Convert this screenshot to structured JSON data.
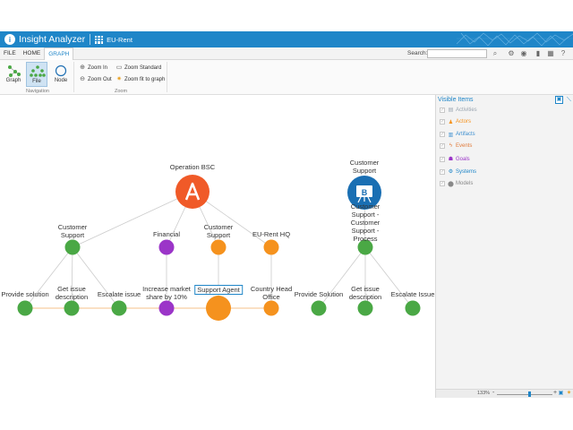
{
  "app": {
    "title": "Insight Analyzer",
    "document": "EU-Rent"
  },
  "menu": {
    "tabs": [
      "FILE",
      "HOME",
      "GRAPH"
    ],
    "active_tab": "GRAPH",
    "search_label": "Search:",
    "search_value": ""
  },
  "ribbon": {
    "buttons": {
      "graph": "Graph",
      "file": "File",
      "node": "Node"
    },
    "navigation_label": "Navigation",
    "zoom": {
      "zoom_in": "Zoom In",
      "zoom_out": "Zoom Out",
      "zoom_standard": "Zoom Standard",
      "zoom_fit": "Zoom fit to graph",
      "group_label": "Zoom"
    }
  },
  "graph": {
    "colors": {
      "actor": "#f5921e",
      "goal": "#9b35c8",
      "process": "#4aa845",
      "model_a": "#f05a28",
      "model_b": "#1a6fb3",
      "edge": "#cccccc",
      "edge_highlight": "#f5c089"
    },
    "labels": {
      "operation_bsc": "Operation BSC",
      "badge_a": "A",
      "cs_top": "Customer Support",
      "badge_b": "B",
      "cs_process": "Customer Support - Customer Support - Process",
      "cs_goal": "Customer Support",
      "financial": "Financial",
      "cs_actor": "Customer Support",
      "eurent_hq": "EU-Rent HQ",
      "provide_solution_1": "Provide solution",
      "get_issue_desc_1": "Get issue description",
      "escalate_issue_1": "Escalate issue",
      "increase_market": "Increase market share by 10%",
      "support_agent": "Support Agent",
      "country_head": "Country Head Office",
      "provide_solution_2": "Provide Solution",
      "get_issue_desc_2": "Get issue description",
      "escalate_issue_2": "Escalate Issue"
    }
  },
  "panel": {
    "title": "Visible Items",
    "items": [
      {
        "label": "Activities",
        "color": "#9aa5b0",
        "icon": "activities-icon"
      },
      {
        "label": "Actors",
        "color": "#f5921e",
        "icon": "actor-icon"
      },
      {
        "label": "Artifacts",
        "color": "#3d8fd0",
        "icon": "artifact-icon"
      },
      {
        "label": "Events",
        "color": "#e07a3a",
        "icon": "event-icon"
      },
      {
        "label": "Goals",
        "color": "#9b35c8",
        "icon": "goal-icon"
      },
      {
        "label": "Systems",
        "color": "#1f86c8",
        "icon": "system-icon"
      },
      {
        "label": "Models",
        "color": "#888888",
        "icon": "model-icon"
      }
    ],
    "zoom_level": "133%"
  }
}
